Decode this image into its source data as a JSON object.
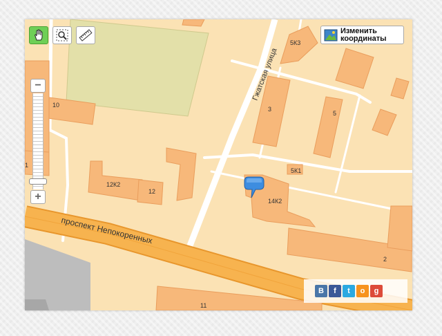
{
  "map": {
    "street_gzhatskaya": "Гжатская улица",
    "avenue_nepokorennykh": "проспект Непокоренных",
    "buildings": {
      "b10": "10",
      "b5k3": "5К3",
      "b3": "3",
      "b5": "5",
      "b5k1": "5К1",
      "b12k2": "12К2",
      "b12": "12",
      "b14k2": "14К2",
      "b2": "2",
      "b11": "11",
      "b1": "1"
    }
  },
  "toolbar": {
    "change_coords_label": "Изменить\nкоординаты"
  },
  "zoom": {
    "minus": "−",
    "plus": "+",
    "level_fraction": 0.92
  },
  "share": {
    "items": [
      {
        "letter": "B",
        "color": "#4a76a8"
      },
      {
        "letter": "f",
        "color": "#3b5998"
      },
      {
        "letter": "t",
        "color": "#2ba9e1"
      },
      {
        "letter": "о",
        "color": "#f7931e"
      },
      {
        "letter": "g",
        "color": "#dd4b39"
      }
    ]
  },
  "colors": {
    "block": "#fbe2b4",
    "building": "#f7b87a",
    "park": "#e3e0a9",
    "road_major": "#f7b34f",
    "road_major_edge": "#e8962c",
    "gray_zone": "#bdbdbd",
    "marker": "#3d8de0"
  }
}
